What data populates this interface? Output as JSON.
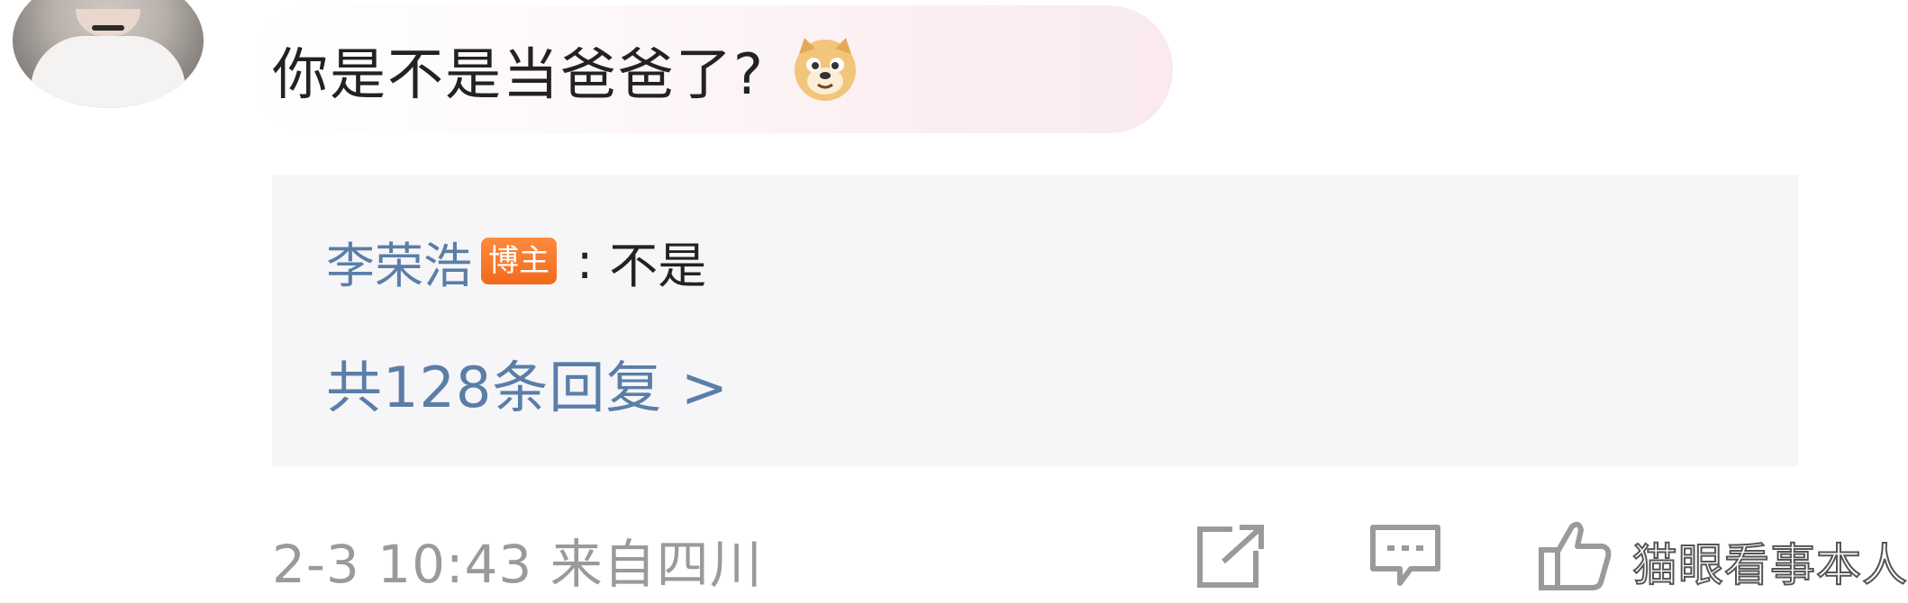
{
  "comment": {
    "text": "你是不是当爸爸了?",
    "emoji_icon": "doge-emoji-icon"
  },
  "reply": {
    "author": "李荣浩",
    "badge": "博主",
    "separator": ":",
    "text": "不是",
    "count_label": "共128条回复 >"
  },
  "meta": {
    "time_location": "2-3 10:43 来自四川"
  },
  "actions": {
    "share_icon": "share-icon",
    "comment_icon": "comment-icon",
    "like_icon": "thumbs-up-icon"
  },
  "watermark": "猫眼看事本人",
  "colors": {
    "link_blue": "#5b7ea8",
    "badge_orange": "#f26a1b",
    "meta_gray": "#9a9a9a",
    "reply_bg": "#f6f6f8"
  }
}
